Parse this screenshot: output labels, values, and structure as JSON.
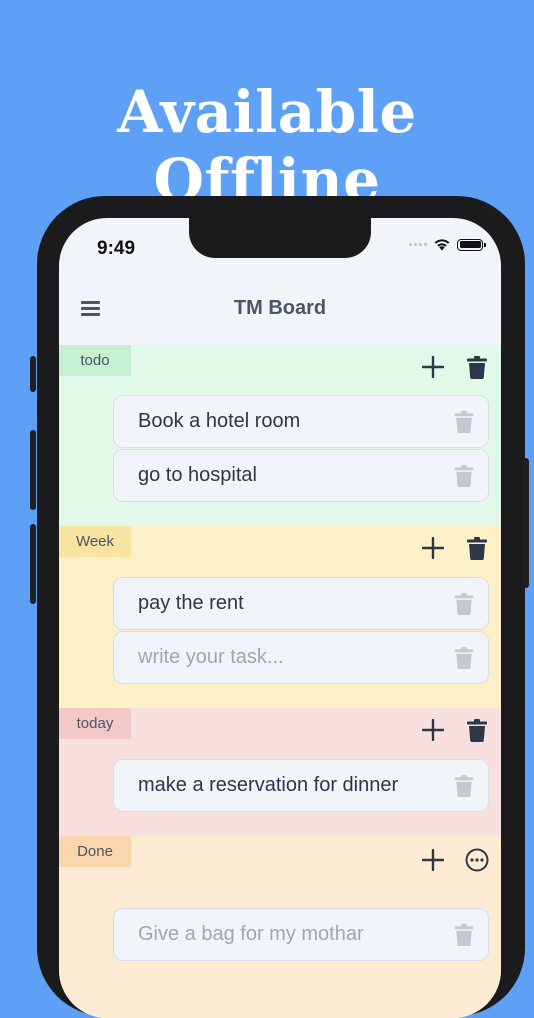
{
  "banner": {
    "headline": "Available Offline"
  },
  "status_bar": {
    "time": "9:49"
  },
  "app": {
    "title": "TM Board"
  },
  "colors": {
    "background": "#5fa0f7",
    "todo_bg": "#e2f8e8",
    "todo_tag": "#c6f0d2",
    "week_bg": "#fcf0c8",
    "week_tag": "#f9e3a0",
    "today_bg": "#f8e0de",
    "today_tag": "#f3c8c6",
    "done_bg": "#fdebd3",
    "done_tag": "#f9d6ad"
  },
  "sections": [
    {
      "label": "todo",
      "tasks": [
        "Book a hotel room",
        "go to hospital"
      ],
      "actions": [
        "plus-icon",
        "trash-icon"
      ]
    },
    {
      "label": "Week",
      "tasks": [
        "pay the rent"
      ],
      "input_placeholder": "write your task...",
      "actions": [
        "plus-icon",
        "trash-icon"
      ]
    },
    {
      "label": "today",
      "tasks": [
        "make a reservation for dinner"
      ],
      "actions": [
        "plus-icon",
        "trash-icon"
      ]
    },
    {
      "label": "Done",
      "input_placeholder": "Give a bag for my mothar",
      "actions": [
        "plus-icon",
        "more-icon"
      ]
    }
  ]
}
